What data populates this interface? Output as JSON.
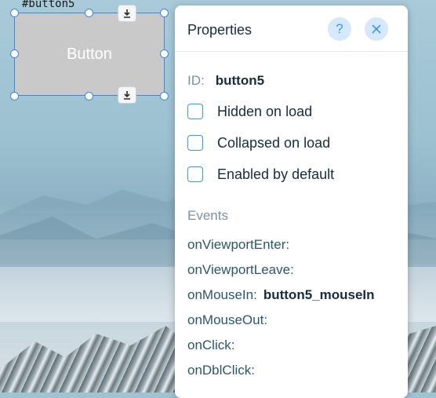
{
  "canvas": {
    "element_id_label": "#button5",
    "button_label": "Button"
  },
  "properties_panel": {
    "title": "Properties",
    "help_icon": "?",
    "id_label": "ID:",
    "id_value": "button5",
    "checkboxes": [
      {
        "label": "Hidden on load",
        "checked": false
      },
      {
        "label": "Collapsed on load",
        "checked": false
      },
      {
        "label": "Enabled by default",
        "checked": false
      }
    ],
    "events_title": "Events",
    "events": [
      {
        "name": "onViewportEnter:",
        "handler": ""
      },
      {
        "name": "onViewportLeave:",
        "handler": ""
      },
      {
        "name": "onMouseIn:",
        "handler": "button5_mouseIn"
      },
      {
        "name": "onMouseOut:",
        "handler": ""
      },
      {
        "name": "onClick:",
        "handler": ""
      },
      {
        "name": "onDblClick:",
        "handler": ""
      }
    ]
  },
  "colors": {
    "accent": "#3899ec",
    "selection_border": "#3b89e3",
    "button_fill": "#c9c9c9"
  }
}
